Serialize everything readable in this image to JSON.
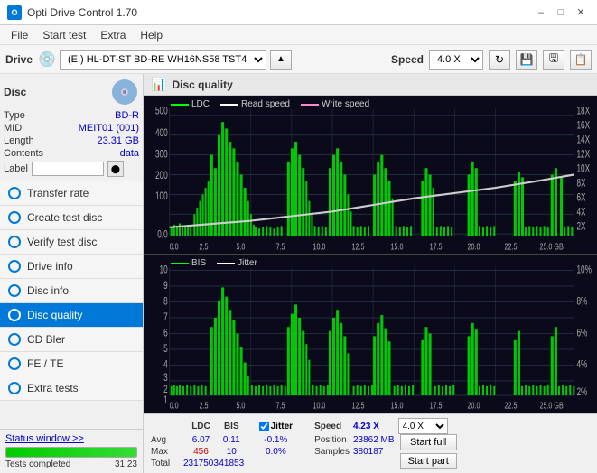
{
  "title_bar": {
    "app_name": "Opti Drive Control 1.70",
    "minimize_label": "–",
    "maximize_label": "□",
    "close_label": "✕"
  },
  "menu": {
    "items": [
      "File",
      "Start test",
      "Extra",
      "Help"
    ]
  },
  "toolbar": {
    "drive_label": "Drive",
    "drive_value": "(E:)  HL-DT-ST BD-RE  WH16NS58 TST4",
    "speed_label": "Speed",
    "speed_value": "4.0 X"
  },
  "disc": {
    "title": "Disc",
    "type_label": "Type",
    "type_value": "BD-R",
    "mid_label": "MID",
    "mid_value": "MEIT01 (001)",
    "length_label": "Length",
    "length_value": "23.31 GB",
    "contents_label": "Contents",
    "contents_value": "data",
    "label_label": "Label"
  },
  "nav": {
    "items": [
      {
        "id": "transfer-rate",
        "label": "Transfer rate",
        "active": false
      },
      {
        "id": "create-test-disc",
        "label": "Create test disc",
        "active": false
      },
      {
        "id": "verify-test-disc",
        "label": "Verify test disc",
        "active": false
      },
      {
        "id": "drive-info",
        "label": "Drive info",
        "active": false
      },
      {
        "id": "disc-info",
        "label": "Disc info",
        "active": false
      },
      {
        "id": "disc-quality",
        "label": "Disc quality",
        "active": true
      },
      {
        "id": "cd-bler",
        "label": "CD Bler",
        "active": false
      },
      {
        "id": "fe-te",
        "label": "FE / TE",
        "active": false
      },
      {
        "id": "extra-tests",
        "label": "Extra tests",
        "active": false
      }
    ]
  },
  "status": {
    "window_btn": "Status window >>",
    "completed_text": "Tests completed",
    "progress": 100,
    "time": "31:23"
  },
  "chart": {
    "title": "Disc quality",
    "legend_top": [
      {
        "label": "LDC",
        "color": "#00ff00"
      },
      {
        "label": "Read speed",
        "color": "#ffffff"
      },
      {
        "label": "Write speed",
        "color": "#ff88cc"
      }
    ],
    "legend_bottom": [
      {
        "label": "BIS",
        "color": "#00ff00"
      },
      {
        "label": "Jitter",
        "color": "#ffffff"
      }
    ],
    "top_y_labels": [
      "500",
      "400",
      "300",
      "200",
      "100",
      "0.0"
    ],
    "top_y_right_labels": [
      "18X",
      "16X",
      "14X",
      "12X",
      "10X",
      "8X",
      "6X",
      "4X",
      "2X"
    ],
    "bottom_y_labels": [
      "10",
      "9",
      "8",
      "7",
      "6",
      "5",
      "4",
      "3",
      "2",
      "1"
    ],
    "bottom_y_right_labels": [
      "10%",
      "8%",
      "6%",
      "4%",
      "2%"
    ],
    "x_labels": [
      "0.0",
      "2.5",
      "5.0",
      "7.5",
      "10.0",
      "12.5",
      "15.0",
      "17.5",
      "20.0",
      "22.5",
      "25.0 GB"
    ]
  },
  "stats": {
    "ldc_label": "LDC",
    "bis_label": "BIS",
    "jitter_label": "Jitter",
    "jitter_checked": true,
    "avg_label": "Avg",
    "max_label": "Max",
    "total_label": "Total",
    "ldc_avg": "6.07",
    "ldc_max": "456",
    "ldc_total": "2317503",
    "bis_avg": "0.11",
    "bis_max": "10",
    "bis_total": "41853",
    "jitter_avg": "-0.1%",
    "jitter_max": "0.0%",
    "jitter_total": "",
    "speed_label": "Speed",
    "speed_value": "4.23 X",
    "speed_dropdown": "4.0 X",
    "position_label": "Position",
    "position_value": "23862 MB",
    "samples_label": "Samples",
    "samples_value": "380187",
    "start_full_label": "Start full",
    "start_part_label": "Start part"
  }
}
